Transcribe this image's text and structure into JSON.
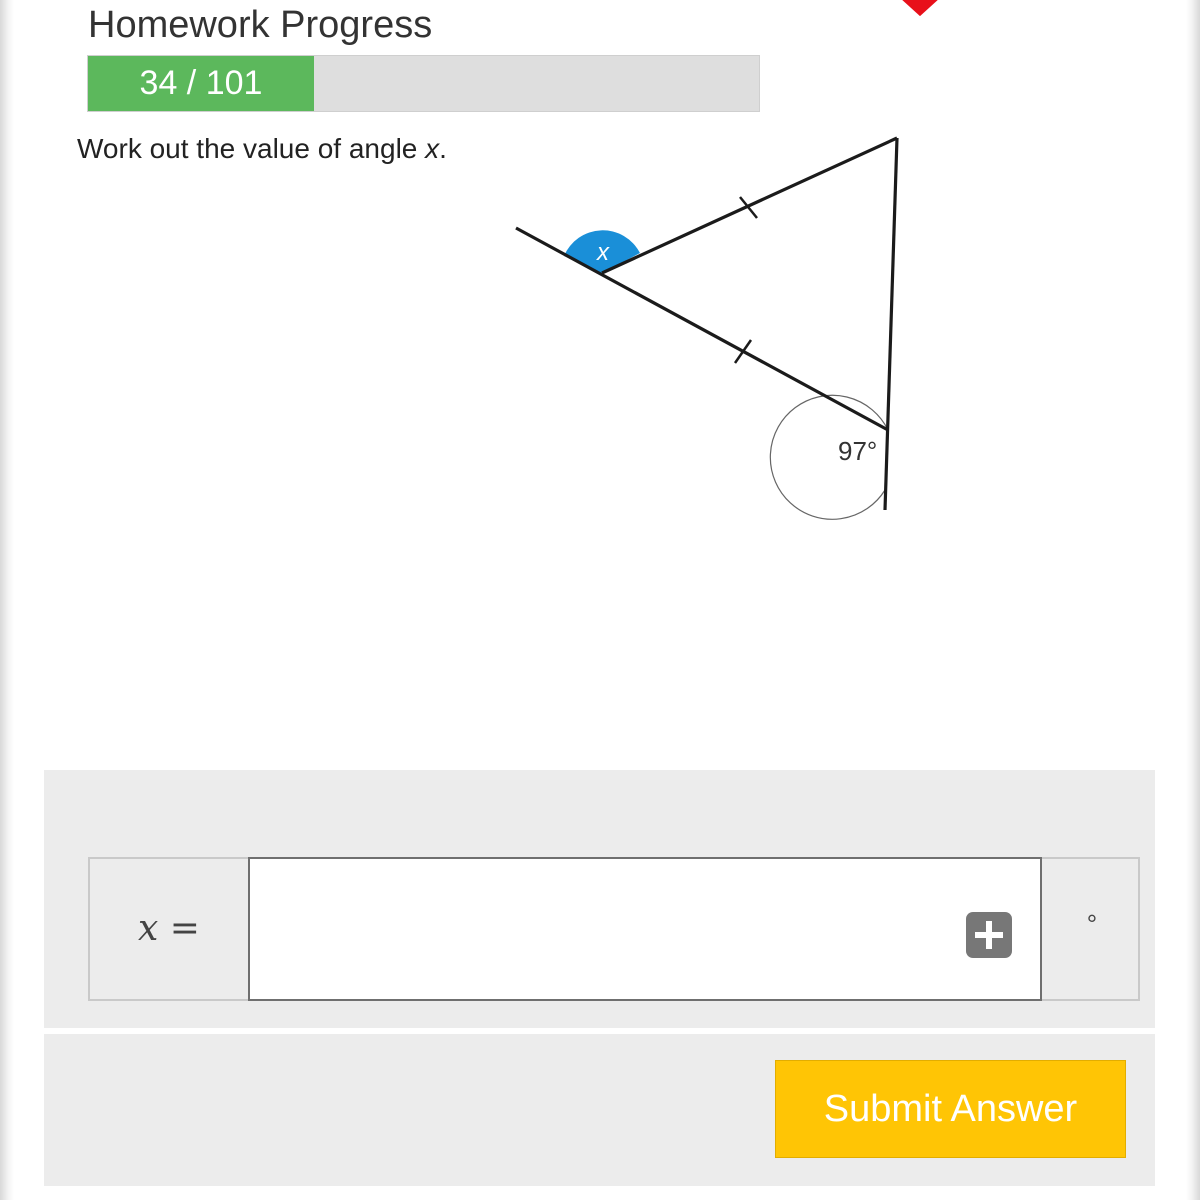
{
  "header": {
    "title": "Homework Progress",
    "progress_label": "34 / 101",
    "progress_completed": 34,
    "progress_total": 101
  },
  "question": {
    "text_before": "Work out the value of angle ",
    "variable": "x",
    "text_after": "."
  },
  "diagram": {
    "angle_label": "x",
    "given_angle_label": "97°",
    "highlight_color": "#1a8fd8"
  },
  "answer": {
    "variable": "x",
    "equals": "=",
    "input_value": "",
    "add_icon": "plus-square-icon",
    "unit": "°"
  },
  "actions": {
    "submit_label": "Submit Answer"
  },
  "colors": {
    "progress_fill": "#5cb85c",
    "submit": "#ffc505",
    "close_mark": "#e8101a"
  },
  "icons": {
    "close": "close-icon"
  }
}
